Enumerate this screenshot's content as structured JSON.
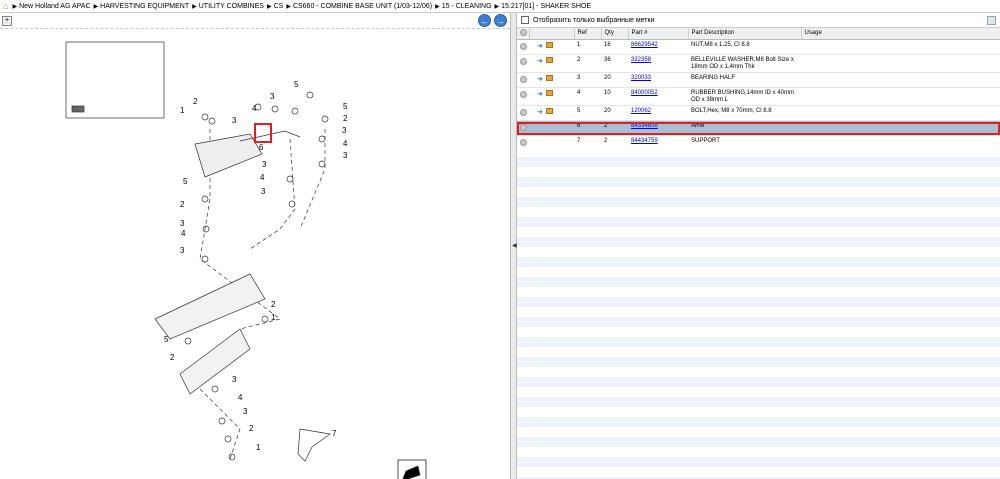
{
  "breadcrumb": {
    "home_icon": "home-icon",
    "items": [
      {
        "label": "New Holland AG APAC"
      },
      {
        "label": "HARVESTING EQUIPMENT"
      },
      {
        "label": "UTILITY COMBINES"
      },
      {
        "label": "CS"
      },
      {
        "label": "CS660 - COMBINE BASE UNIT (1/03-12/06)"
      },
      {
        "label": "15 - CLEANING"
      },
      {
        "label": "15.217[01] - SHAKER SHOE"
      }
    ]
  },
  "left_toolbar": {
    "tool_label": "+",
    "prev_glyph": "←",
    "next_glyph": "→"
  },
  "filter": {
    "label": "Отобразить только выбранные метки",
    "checked": false
  },
  "table": {
    "columns": [
      "",
      "",
      "Ref",
      "Qty",
      "Part #",
      "Part Description",
      "Usage"
    ],
    "rows": [
      {
        "ref": "1",
        "qty": "16",
        "part": "86629542",
        "desc": "NUT,M8 x 1.25, Cl 8.8",
        "usage": ""
      },
      {
        "ref": "2",
        "qty": "36",
        "part": "322358",
        "desc": "BELLEVILLE WASHER,M8 Bolt Size x 18mm OD x 1.4mm Thk",
        "usage": ""
      },
      {
        "ref": "3",
        "qty": "20",
        "part": "320033",
        "desc": "BEARING HALF",
        "usage": ""
      },
      {
        "ref": "4",
        "qty": "10",
        "part": "84000052",
        "desc": "RUBBER BUSHING,14mm ID x 40mm OD x 38mm L",
        "usage": ""
      },
      {
        "ref": "5",
        "qty": "20",
        "part": "120062",
        "desc": "BOLT,Hex, M8 x 70mm, Cl 8.8",
        "usage": ""
      },
      {
        "ref": "6",
        "qty": "2",
        "part": "84334808",
        "desc": "ARM",
        "usage": "",
        "selected": true
      },
      {
        "ref": "7",
        "qty": "2",
        "part": "84434759",
        "desc": "SUPPORT",
        "usage": ""
      }
    ]
  },
  "diagram": {
    "selected_ref": "6",
    "callouts": [
      "1",
      "2",
      "3",
      "4",
      "5",
      "6",
      "7"
    ]
  },
  "colors": {
    "selection_outline": "#e02020",
    "selected_row": "#a9bfd4",
    "link": "#0000ee",
    "nav_button": "#3d7fd1"
  }
}
